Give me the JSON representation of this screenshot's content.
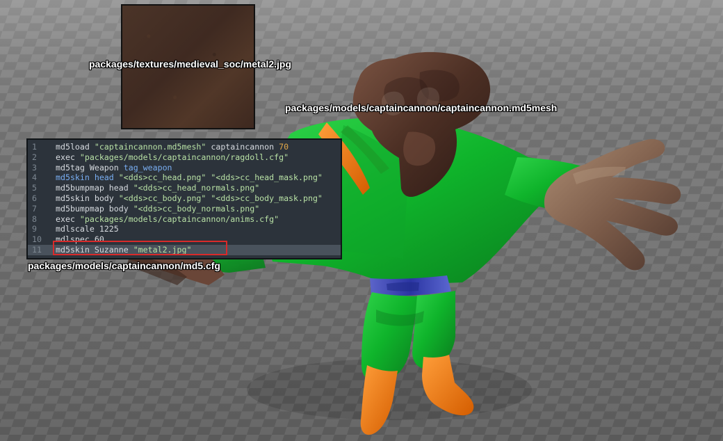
{
  "scene": {
    "texture_label": "packages/textures/medieval_soc/metal2.jpg",
    "mesh_label": "packages/models/captaincannon/captaincannon.md5mesh",
    "cfg_label": "packages/models/captaincannon/md5.cfg",
    "colors": {
      "background": "#6f6f6f",
      "editor_background": "#2c333b",
      "highlight_border": "#d92a2a",
      "string": "#b8e1a5",
      "blue": "#79aef2",
      "number": "#e3a84a"
    }
  },
  "editor": {
    "lines": [
      {
        "line_no": "1",
        "segments": [
          {
            "text": "md5load ",
            "style": "plain"
          },
          {
            "text": "\"captaincannon.md5mesh\"",
            "style": "string"
          },
          {
            "text": " captaincannon ",
            "style": "plain"
          },
          {
            "text": "70",
            "style": "number"
          }
        ]
      },
      {
        "line_no": "2",
        "segments": [
          {
            "text": "exec ",
            "style": "plain"
          },
          {
            "text": "\"packages/models/captaincannon/ragdoll.cfg\"",
            "style": "string"
          }
        ]
      },
      {
        "line_no": "3",
        "segments": [
          {
            "text": "md5tag Weapon ",
            "style": "plain"
          },
          {
            "text": "tag_weapon",
            "style": "blue"
          }
        ]
      },
      {
        "line_no": "4",
        "segments": [
          {
            "text": "md5skin head ",
            "style": "blue"
          },
          {
            "text": "\"<dds>cc_head.png\"",
            "style": "string"
          },
          {
            "text": " ",
            "style": "plain"
          },
          {
            "text": "\"<dds>cc_head_mask.png\"",
            "style": "string"
          }
        ]
      },
      {
        "line_no": "5",
        "segments": [
          {
            "text": "md5bumpmap head ",
            "style": "plain"
          },
          {
            "text": "\"<dds>cc_head_normals.png\"",
            "style": "string"
          }
        ]
      },
      {
        "line_no": "6",
        "segments": [
          {
            "text": "md5skin body ",
            "style": "plain"
          },
          {
            "text": "\"<dds>cc_body.png\"",
            "style": "string"
          },
          {
            "text": " ",
            "style": "plain"
          },
          {
            "text": "\"<dds>cc_body_mask.png\"",
            "style": "string"
          }
        ]
      },
      {
        "line_no": "7",
        "segments": [
          {
            "text": "md5bumpmap body ",
            "style": "plain"
          },
          {
            "text": "\"<dds>cc_body_normals.png\"",
            "style": "string"
          }
        ]
      },
      {
        "line_no": "8",
        "segments": [
          {
            "text": "exec ",
            "style": "plain"
          },
          {
            "text": "\"packages/models/captaincannon/anims.cfg\"",
            "style": "string"
          }
        ]
      },
      {
        "line_no": "9",
        "segments": [
          {
            "text": "mdlscale 1225",
            "style": "plain"
          }
        ]
      },
      {
        "line_no": "10",
        "segments": [
          {
            "text": "mdlspec 60",
            "style": "plain"
          }
        ]
      },
      {
        "line_no": "11",
        "segments": [
          {
            "text": "md5skin Suzanne ",
            "style": "plain"
          },
          {
            "text": "\"metal2.jpg\"",
            "style": "string"
          }
        ],
        "highlighted": true
      }
    ]
  }
}
